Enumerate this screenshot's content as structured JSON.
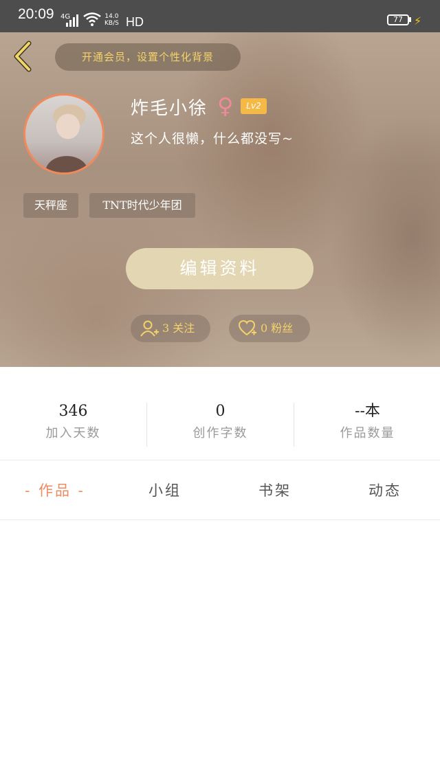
{
  "status_bar": {
    "time": "20:09",
    "network": "4G",
    "speed_value": "14.0",
    "speed_unit": "KB/S",
    "hd": "HD",
    "battery": "77"
  },
  "header": {
    "vip_prompt": "开通会员，设置个性化背景",
    "username": "炸毛小徐",
    "gender_symbol": "♀",
    "level": "Lv2",
    "bio": "这个人很懒，什么都没写~",
    "tags": [
      "天秤座",
      "TNT时代少年团"
    ],
    "edit_button": "编辑资料",
    "following": "3 关注",
    "fans": "0 粉丝"
  },
  "stats": [
    {
      "value": "346",
      "label": "加入天数"
    },
    {
      "value": "0",
      "label": "创作字数"
    },
    {
      "value": "--本",
      "label": "作品数量"
    }
  ],
  "tabs": [
    {
      "label": "-  作品  -",
      "active": true
    },
    {
      "label": "小组",
      "active": false
    },
    {
      "label": "书架",
      "active": false
    },
    {
      "label": "动态",
      "active": false
    }
  ],
  "colors": {
    "accent": "#f08a5d",
    "gold": "#f3d36b",
    "level_badge": "#f5b947"
  }
}
